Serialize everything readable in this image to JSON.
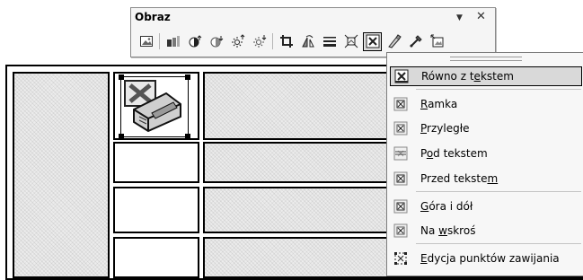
{
  "toolbar": {
    "title": "Obraz",
    "dropdown_glyph": "▼",
    "close_glyph": "✕",
    "buttons": [
      {
        "name": "insert-picture-icon"
      },
      {
        "name": "color-icon"
      },
      {
        "name": "more-contrast-icon"
      },
      {
        "name": "less-contrast-icon"
      },
      {
        "name": "more-brightness-icon"
      },
      {
        "name": "less-brightness-icon"
      },
      {
        "name": "crop-icon"
      },
      {
        "name": "rotate-left-icon"
      },
      {
        "name": "line-style-icon"
      },
      {
        "name": "compress-pictures-icon"
      },
      {
        "name": "text-wrapping-icon"
      },
      {
        "name": "format-picture-icon"
      },
      {
        "name": "set-transparent-color-icon"
      },
      {
        "name": "reset-picture-icon"
      }
    ]
  },
  "menu": {
    "items": [
      {
        "pre": "Równo z t",
        "u": "e",
        "post": "kstem",
        "icon": "in-line-with-text-icon",
        "selected": true
      },
      {
        "pre": "",
        "u": "R",
        "post": "amka",
        "icon": "square-wrap-icon"
      },
      {
        "pre": "",
        "u": "P",
        "post": "rzyległe",
        "icon": "tight-wrap-icon"
      },
      {
        "pre": "P",
        "u": "o",
        "post": "d tekstem",
        "icon": "behind-text-icon"
      },
      {
        "pre": "Przed tekste",
        "u": "m",
        "post": "",
        "icon": "in-front-of-text-icon"
      },
      {
        "pre": "",
        "u": "G",
        "post": "óra i dół",
        "icon": "top-and-bottom-icon"
      },
      {
        "pre": "Na ",
        "u": "w",
        "post": "skroś",
        "icon": "through-wrap-icon"
      },
      {
        "pre": "",
        "u": "E",
        "post": "dycja punktów zawijania",
        "icon": "edit-wrap-points-icon"
      }
    ]
  }
}
